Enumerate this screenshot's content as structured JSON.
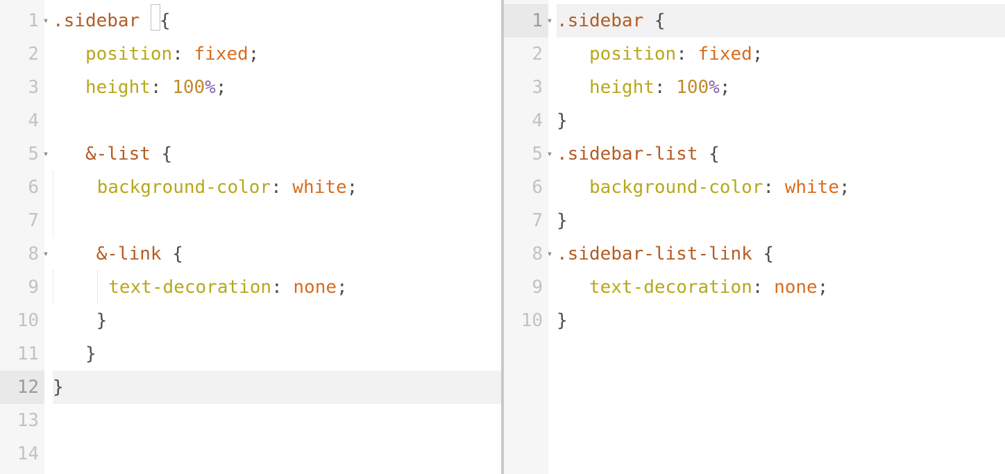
{
  "left": {
    "highlighted_line": 12,
    "last_line": 14,
    "lines": [
      {
        "n": 1,
        "fold": true,
        "tokens": [
          {
            "t": ".sidebar ",
            "c": "tok-selector"
          },
          {
            "t": "{",
            "c": "tok-brace",
            "cursor_before": true
          }
        ]
      },
      {
        "n": 2,
        "fold": false,
        "tokens": [
          {
            "t": "   ",
            "c": ""
          },
          {
            "t": "position",
            "c": "tok-prop"
          },
          {
            "t": ": ",
            "c": "tok-punc"
          },
          {
            "t": "fixed",
            "c": "tok-value"
          },
          {
            "t": ";",
            "c": "tok-punc"
          }
        ]
      },
      {
        "n": 3,
        "fold": false,
        "tokens": [
          {
            "t": "   ",
            "c": ""
          },
          {
            "t": "height",
            "c": "tok-prop"
          },
          {
            "t": ": ",
            "c": "tok-punc"
          },
          {
            "t": "100",
            "c": "tok-num"
          },
          {
            "t": "%",
            "c": "tok-unit"
          },
          {
            "t": ";",
            "c": "tok-punc"
          }
        ]
      },
      {
        "n": 4,
        "fold": false,
        "tokens": [
          {
            "t": "",
            "c": ""
          }
        ]
      },
      {
        "n": 5,
        "fold": true,
        "tokens": [
          {
            "t": "   ",
            "c": ""
          },
          {
            "t": "&",
            "c": "tok-amp"
          },
          {
            "t": "-list ",
            "c": "tok-selector"
          },
          {
            "t": "{",
            "c": "tok-brace"
          }
        ]
      },
      {
        "n": 6,
        "fold": false,
        "tokens": [
          {
            "t": "   ",
            "c": "",
            "guide": true
          },
          {
            "t": " background-color",
            "c": "tok-prop"
          },
          {
            "t": ": ",
            "c": "tok-punc"
          },
          {
            "t": "white",
            "c": "tok-value"
          },
          {
            "t": ";",
            "c": "tok-punc"
          }
        ]
      },
      {
        "n": 7,
        "fold": false,
        "tokens": [
          {
            "t": "   ",
            "c": "",
            "guide": true
          },
          {
            "t": "",
            "c": ""
          }
        ]
      },
      {
        "n": 8,
        "fold": true,
        "tokens": [
          {
            "t": "    ",
            "c": ""
          },
          {
            "t": "&",
            "c": "tok-amp"
          },
          {
            "t": "-link ",
            "c": "tok-selector"
          },
          {
            "t": "{",
            "c": "tok-brace"
          }
        ]
      },
      {
        "n": 9,
        "fold": false,
        "tokens": [
          {
            "t": "    ",
            "c": "",
            "guide": true
          },
          {
            "t": " ",
            "c": "",
            "guide": true
          },
          {
            "t": "text-decoration",
            "c": "tok-prop"
          },
          {
            "t": ": ",
            "c": "tok-punc"
          },
          {
            "t": "none",
            "c": "tok-value"
          },
          {
            "t": ";",
            "c": "tok-punc"
          }
        ]
      },
      {
        "n": 10,
        "fold": false,
        "tokens": [
          {
            "t": "    ",
            "c": ""
          },
          {
            "t": "}",
            "c": "tok-brace"
          }
        ]
      },
      {
        "n": 11,
        "fold": false,
        "tokens": [
          {
            "t": "   ",
            "c": ""
          },
          {
            "t": "}",
            "c": "tok-brace"
          }
        ]
      },
      {
        "n": 12,
        "fold": false,
        "tokens": [
          {
            "t": "}",
            "c": "tok-brace"
          }
        ]
      },
      {
        "n": 13,
        "fold": false,
        "tokens": [
          {
            "t": "",
            "c": ""
          }
        ]
      },
      {
        "n": 14,
        "fold": false,
        "tokens": [
          {
            "t": "",
            "c": ""
          }
        ]
      }
    ]
  },
  "right": {
    "highlighted_line": 1,
    "last_line": 10,
    "lines": [
      {
        "n": 1,
        "fold": true,
        "tokens": [
          {
            "t": ".sidebar ",
            "c": "tok-selector"
          },
          {
            "t": "{",
            "c": "tok-brace"
          }
        ]
      },
      {
        "n": 2,
        "fold": false,
        "tokens": [
          {
            "t": "   ",
            "c": ""
          },
          {
            "t": "position",
            "c": "tok-prop"
          },
          {
            "t": ": ",
            "c": "tok-punc"
          },
          {
            "t": "fixed",
            "c": "tok-value"
          },
          {
            "t": ";",
            "c": "tok-punc"
          }
        ]
      },
      {
        "n": 3,
        "fold": false,
        "tokens": [
          {
            "t": "   ",
            "c": ""
          },
          {
            "t": "height",
            "c": "tok-prop"
          },
          {
            "t": ": ",
            "c": "tok-punc"
          },
          {
            "t": "100",
            "c": "tok-num"
          },
          {
            "t": "%",
            "c": "tok-unit"
          },
          {
            "t": ";",
            "c": "tok-punc"
          }
        ]
      },
      {
        "n": 4,
        "fold": false,
        "tokens": [
          {
            "t": "}",
            "c": "tok-brace"
          }
        ]
      },
      {
        "n": 5,
        "fold": true,
        "tokens": [
          {
            "t": ".sidebar-list ",
            "c": "tok-selector"
          },
          {
            "t": "{",
            "c": "tok-brace"
          }
        ]
      },
      {
        "n": 6,
        "fold": false,
        "tokens": [
          {
            "t": "   ",
            "c": ""
          },
          {
            "t": "background-color",
            "c": "tok-prop"
          },
          {
            "t": ": ",
            "c": "tok-punc"
          },
          {
            "t": "white",
            "c": "tok-value"
          },
          {
            "t": ";",
            "c": "tok-punc"
          }
        ]
      },
      {
        "n": 7,
        "fold": false,
        "tokens": [
          {
            "t": "}",
            "c": "tok-brace"
          }
        ]
      },
      {
        "n": 8,
        "fold": true,
        "tokens": [
          {
            "t": ".sidebar-list-link ",
            "c": "tok-selector"
          },
          {
            "t": "{",
            "c": "tok-brace"
          }
        ]
      },
      {
        "n": 9,
        "fold": false,
        "tokens": [
          {
            "t": "   ",
            "c": ""
          },
          {
            "t": "text-decoration",
            "c": "tok-prop"
          },
          {
            "t": ": ",
            "c": "tok-punc"
          },
          {
            "t": "none",
            "c": "tok-value"
          },
          {
            "t": ";",
            "c": "tok-punc"
          }
        ]
      },
      {
        "n": 10,
        "fold": false,
        "tokens": [
          {
            "t": "}",
            "c": "tok-brace"
          }
        ]
      }
    ]
  }
}
